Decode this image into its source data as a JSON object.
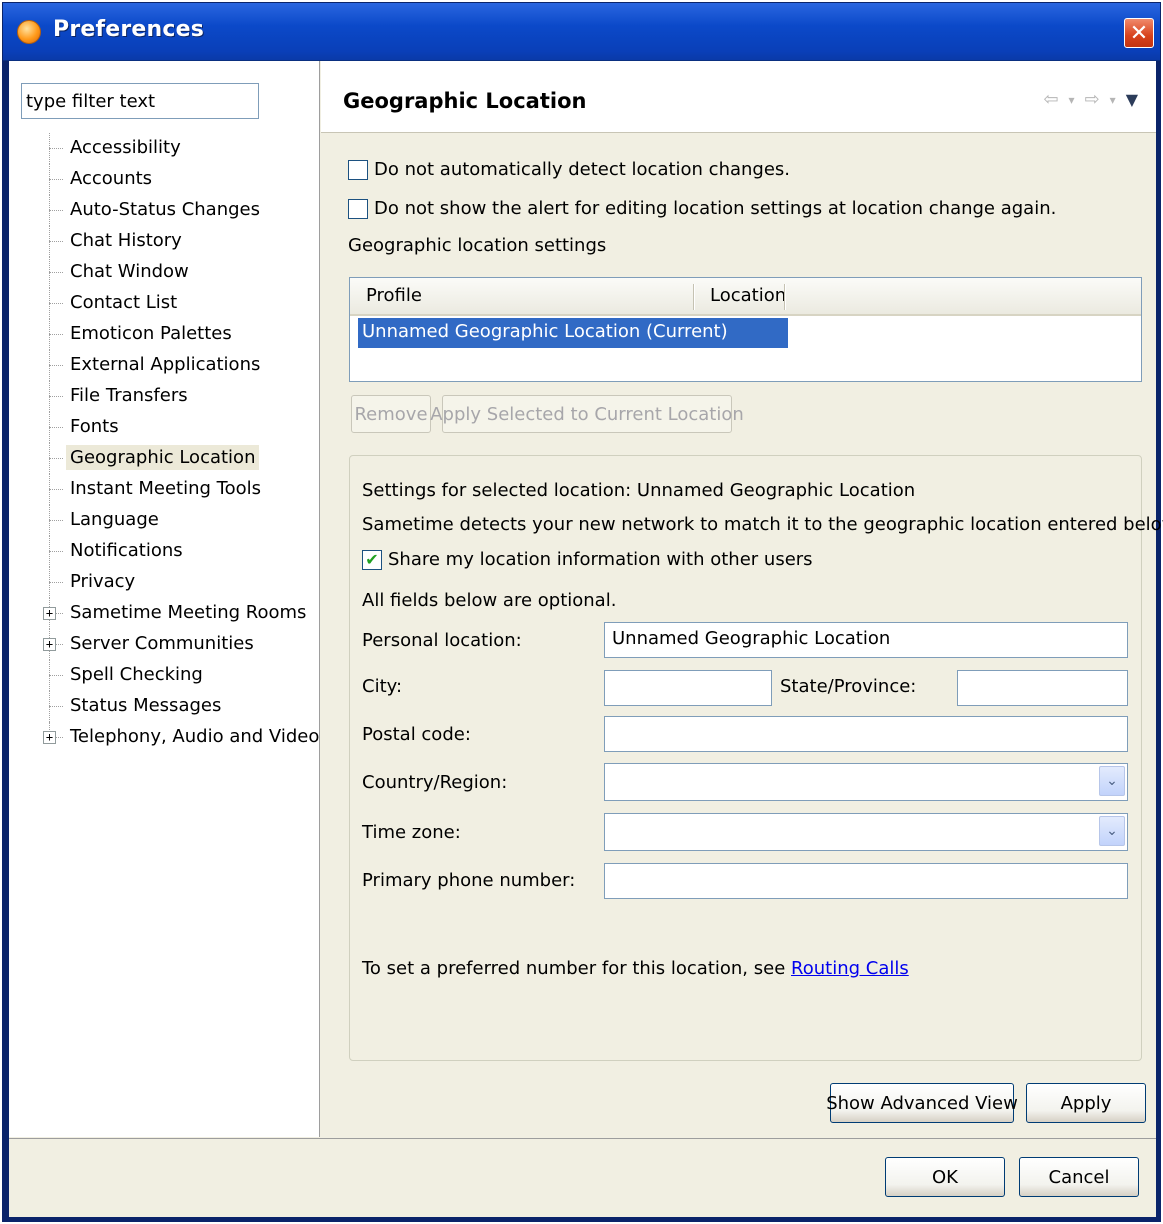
{
  "window": {
    "title": "Preferences",
    "close_glyph": "✕"
  },
  "filter": {
    "value": "type filter text"
  },
  "tree": {
    "items": [
      {
        "label": "Accessibility",
        "expandable": false
      },
      {
        "label": "Accounts",
        "expandable": false
      },
      {
        "label": "Auto-Status Changes",
        "expandable": false
      },
      {
        "label": "Chat History",
        "expandable": false
      },
      {
        "label": "Chat Window",
        "expandable": false
      },
      {
        "label": "Contact List",
        "expandable": false
      },
      {
        "label": "Emoticon Palettes",
        "expandable": false
      },
      {
        "label": "External Applications",
        "expandable": false
      },
      {
        "label": "File Transfers",
        "expandable": false
      },
      {
        "label": "Fonts",
        "expandable": false
      },
      {
        "label": "Geographic Location",
        "expandable": false,
        "selected": true
      },
      {
        "label": "Instant Meeting Tools",
        "expandable": false
      },
      {
        "label": "Language",
        "expandable": false
      },
      {
        "label": "Notifications",
        "expandable": false
      },
      {
        "label": "Privacy",
        "expandable": false
      },
      {
        "label": "Sametime Meeting Rooms",
        "expandable": true
      },
      {
        "label": "Server Communities",
        "expandable": true
      },
      {
        "label": "Spell Checking",
        "expandable": false
      },
      {
        "label": "Status Messages",
        "expandable": false
      },
      {
        "label": "Telephony, Audio and Video",
        "expandable": true
      }
    ]
  },
  "page": {
    "title": "Geographic Location",
    "nav": {
      "back_glyph": "⇦",
      "forward_glyph": "⇨",
      "dropdown_glyph": "▾",
      "menu_glyph": "▼"
    },
    "checkbox_detect": {
      "label": "Do not automatically detect location changes.",
      "checked": false
    },
    "checkbox_alert": {
      "label": "Do not show the alert for editing location settings at location change again.",
      "checked": false
    },
    "settings_heading": "Geographic location settings",
    "table": {
      "columns": [
        "Profile",
        "Location"
      ],
      "rows": [
        {
          "profile": "Unnamed Geographic Location (Current)",
          "location": ""
        }
      ]
    },
    "buttons": {
      "remove": "Remove",
      "apply_selected": "Apply Selected to Current Location"
    },
    "group": {
      "selected_text": "Settings for selected location: Unnamed Geographic Location",
      "detect_text": "Sametime detects your new network to match it to the geographic location entered below.",
      "share": {
        "label": "Share my location information with other users",
        "checked": true,
        "check_glyph": "✔"
      },
      "optional_text": "All fields below are optional.",
      "fields": {
        "personal_location": {
          "label": "Personal location:",
          "value": "Unnamed Geographic Location"
        },
        "city": {
          "label": "City:",
          "value": ""
        },
        "state": {
          "label": "State/Province:",
          "value": ""
        },
        "postal": {
          "label": "Postal code:",
          "value": ""
        },
        "country": {
          "label": "Country/Region:",
          "value": ""
        },
        "timezone": {
          "label": "Time zone:",
          "value": ""
        },
        "phone": {
          "label": "Primary phone number:",
          "value": ""
        }
      },
      "routing_text": "To set a preferred number for this location, see ",
      "routing_link": "Routing Calls",
      "combo_glyph": "⌄"
    },
    "actions": {
      "show_advanced": "Show Advanced View",
      "apply": "Apply"
    }
  },
  "dialog_buttons": {
    "ok": "OK",
    "cancel": "Cancel"
  }
}
